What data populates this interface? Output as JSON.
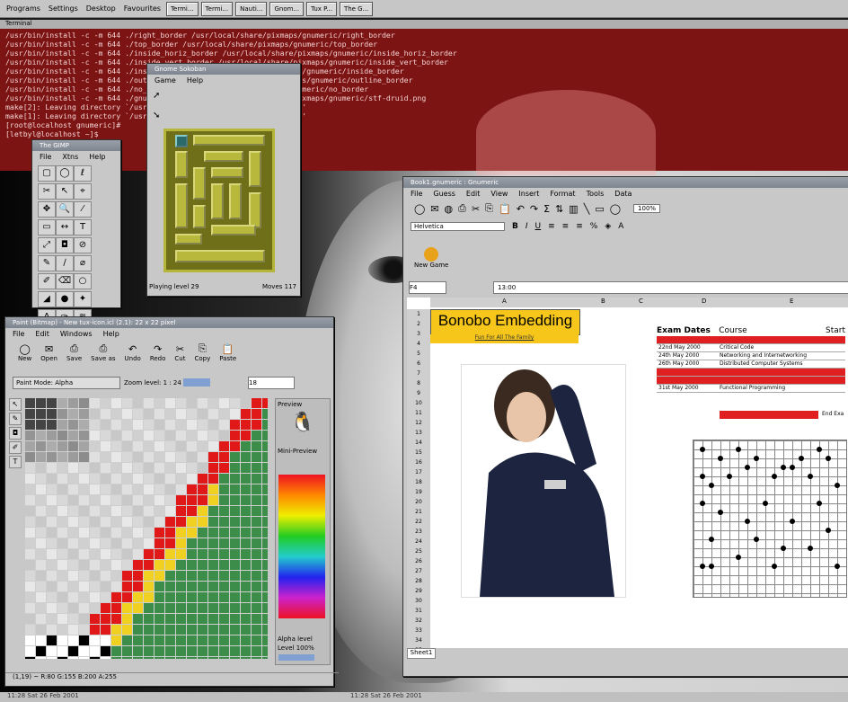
{
  "taskbar": {
    "menus": [
      "Programs",
      "Settings",
      "Desktop",
      "Favourites"
    ],
    "buttons": [
      "Termi...",
      "Termi...",
      "Nauti...",
      "Gnom...",
      "Tux P...",
      "The G..."
    ]
  },
  "terminal": {
    "title": "Terminal",
    "lines": [
      "/usr/bin/install -c -m 644 ./right_border /usr/local/share/pixmaps/gnumeric/right_border",
      "/usr/bin/install -c -m 644 ./top_border /usr/local/share/pixmaps/gnumeric/top_border",
      "/usr/bin/install -c -m 644 ./inside_horiz_border /usr/local/share/pixmaps/gnumeric/inside_horiz_border",
      "/usr/bin/install -c -m 644 ./inside_vert_border /usr/local/share/pixmaps/gnumeric/inside_vert_border",
      "/usr/bin/install -c -m 644 ./inside_border /usr/local/share/pixmaps/gnumeric/inside_border",
      "/usr/bin/install -c -m 644 ./outline_border /usr/local/share/pixmaps/gnumeric/outline_border",
      "/usr/bin/install -c -m 644 ./no_border /usr/local/share/pixmaps/gnumeric/no_border",
      "/usr/bin/install -c -m 644 ./gnumeric-druid.png /usr/local/share/pixmaps/gnumeric/stf-druid.png",
      "make[2]: Leaving directory `/usr/local/share/pixmaps/gnumeric/icons'",
      "make[1]: Leaving directory `/usr/local/share/pixmaps/gnumeric/icons'",
      "[root@localhost gnumeric]#",
      "[letbyl@localhost ~]$"
    ]
  },
  "tools": {
    "title": "The GIMP",
    "menu": [
      "File",
      "Xtns",
      "Help"
    ],
    "icons": [
      "▢",
      "◯",
      "ℓ",
      "✂",
      "↖",
      "⌖",
      "✥",
      "🔍",
      "⁄",
      "▭",
      "↔",
      "T",
      "⤢",
      "◘",
      "⊘",
      "✎",
      "∕",
      "⌀",
      "✐",
      "⌫",
      "○",
      "◢",
      "●",
      "✦",
      "A",
      "✑",
      "≋"
    ]
  },
  "puzzle": {
    "title": "Gnome Sokoban",
    "menu": [
      "Game",
      "Help"
    ],
    "status_left": "Playing level 29",
    "status_right": "Moves 117"
  },
  "paint": {
    "title": "Paint (Bitmap) - New tux-icon.icl (2.1): 22 x 22 pixel",
    "menu": [
      "File",
      "Edit",
      "Windows",
      "Help"
    ],
    "toolbar": [
      "New",
      "Open",
      "Save",
      "Save as",
      "Undo",
      "Redo",
      "Cut",
      "Copy",
      "Paste"
    ],
    "mode_label": "Paint Mode: Alpha",
    "zoom_label": "Zoom level: 1 : 24",
    "zoom_value": "18",
    "preview_label": "Preview",
    "minipreview_label": "Mini-Preview",
    "alpha_label": "Alpha level",
    "alpha_value": "Level 100%",
    "status": "(1,19) ~ R:80 G:155 B:200 A:255"
  },
  "sheet": {
    "title": "Book1.gnumeric : Gnumeric",
    "menu": [
      "File",
      "Guess",
      "Edit",
      "View",
      "Insert",
      "Format",
      "Tools",
      "Data"
    ],
    "font": "Helvetica",
    "zoom": "100%",
    "new_game_label": "New Game",
    "cell_ref": "F4",
    "formula": "13:00",
    "columns": [
      "A",
      "B",
      "C",
      "D",
      "E"
    ],
    "headline": "Bonobo Embedding",
    "subline": "Fun For All The Family",
    "exam_header_date": "Exam Dates",
    "exam_header_course": "Course",
    "exam_header_start": "Start",
    "exams": [
      {
        "date": "",
        "course": "",
        "color": "#e02020"
      },
      {
        "date": "22nd May 2000",
        "course": "Critical Code",
        "color": "#ffffff"
      },
      {
        "date": "24th May 2000",
        "course": "Networking and Internetworking",
        "color": "#ffffff"
      },
      {
        "date": "26th May 2000",
        "course": "Distributed Computer Systems",
        "color": "#ffffff"
      },
      {
        "date": "",
        "course": "",
        "color": "#e02020"
      },
      {
        "date": "",
        "course": "",
        "color": "#e02020"
      },
      {
        "date": "31st May 2000",
        "course": "Functional Programming",
        "color": "#ffffff"
      }
    ],
    "end_label": "End Exa",
    "sheet_tab": "Sheet1",
    "row_numbers": [
      "1",
      "2",
      "3",
      "4",
      "5",
      "6",
      "7",
      "8",
      "9",
      "10",
      "11",
      "12",
      "13",
      "14",
      "15",
      "16",
      "17",
      "18",
      "19",
      "20",
      "21",
      "22",
      "23",
      "24",
      "25",
      "26",
      "27",
      "28",
      "29",
      "30",
      "31",
      "32",
      "33",
      "34",
      "35"
    ]
  },
  "bottombar": {
    "left": "11:28 Sat 26 Feb 2001",
    "right": "11:28 Sat 26 Feb 2001"
  }
}
